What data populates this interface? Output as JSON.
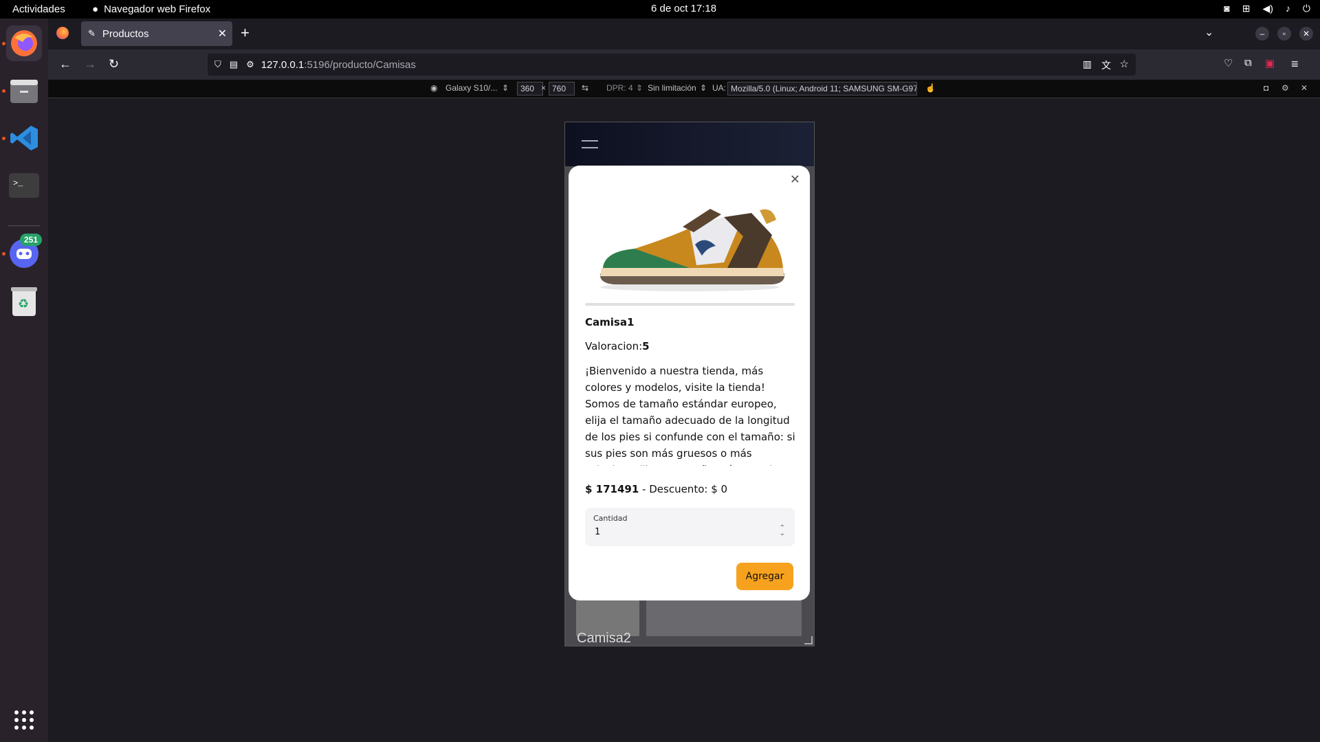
{
  "topbar": {
    "activities": "Actividades",
    "app_name": "Navegador web Firefox",
    "clock": "6 de oct  17:18"
  },
  "dock": {
    "discord_badge": "251"
  },
  "browser": {
    "tab_title": "Productos",
    "url_host": "127.0.0.1",
    "url_rest": ":5196/producto/Camisas"
  },
  "rdm": {
    "device": "Galaxy S10/...",
    "width": "360",
    "height": "760",
    "dpr": "DPR: 4",
    "throttle": "Sin limitación",
    "ua_label": "UA:",
    "ua_value": "Mozilla/5.0 (Linux; Android 11; SAMSUNG SM-G97"
  },
  "page": {
    "next_title": "Camisa2"
  },
  "modal": {
    "name": "Camisa1",
    "rating_label": "Valoracion:",
    "rating_value": "5",
    "description": "¡Bienvenido a nuestra tienda, más colores y modelos, visite la tienda! Somos de tamaño estándar europeo, elija el tamaño adecuado de la longitud de los pies si confunde con el tamaño: si sus pies son más gruesos o más salvajes, elija un tamaño más grande tabla de tallas",
    "price": "$ 171491",
    "discount": " - Descuento: $ 0",
    "qty_label": "Cantidad",
    "qty_value": "1",
    "add_button": "Agregar"
  }
}
